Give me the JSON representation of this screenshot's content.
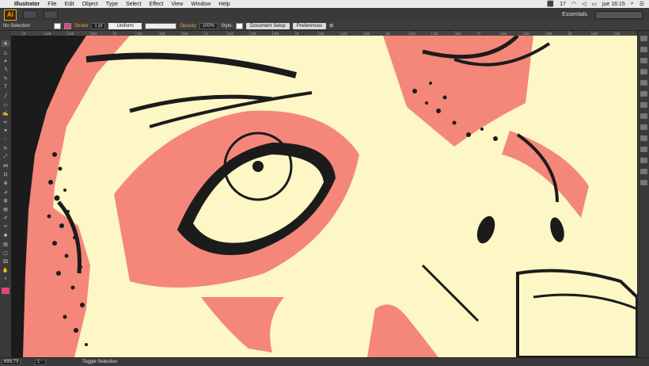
{
  "menubar": {
    "app": "Illustrator",
    "items": [
      "File",
      "Edit",
      "Object",
      "Type",
      "Select",
      "Effect",
      "View",
      "Window",
      "Help"
    ],
    "status": {
      "adobe_count": "17",
      "day_time": "jue 16:15"
    }
  },
  "appbar": {
    "logo": "Ai",
    "workspace": "Essentials"
  },
  "control": {
    "selection": "No Selection",
    "stroke_label": "Stroke",
    "stroke_weight": "1 pt",
    "profile": "Uniform",
    "opacity_label": "Opacity",
    "opacity_value": "100%",
    "style_label": "Style:",
    "document_setup": "Document Setup",
    "preferences": "Preferences"
  },
  "ruler": {
    "ticks": [
      "2",
      "1/4",
      "1/2",
      "3/4",
      "3",
      "1/4",
      "1/2",
      "3/4",
      "4",
      "1/4",
      "1/2",
      "3/4",
      "5",
      "1/4",
      "1/2",
      "3/4",
      "6",
      "1/4",
      "1/2",
      "3/4",
      "7",
      "1/4",
      "1/2",
      "3/4",
      "8",
      "1/4",
      "1/2"
    ]
  },
  "statusbar": {
    "zoom": "899,73",
    "page": "1",
    "tool": "Toggle Selection"
  },
  "icons": {
    "tools": [
      "selection-tool-icon",
      "direct-selection-tool-icon",
      "magic-wand-tool-icon",
      "lasso-tool-icon",
      "pen-tool-icon",
      "type-tool-icon",
      "line-tool-icon",
      "rectangle-tool-icon",
      "paintbrush-tool-icon",
      "pencil-tool-icon",
      "blob-brush-tool-icon",
      "eraser-tool-icon",
      "rotate-tool-icon",
      "scale-tool-icon",
      "width-tool-icon",
      "free-transform-tool-icon",
      "shape-builder-tool-icon",
      "perspective-grid-tool-icon",
      "mesh-tool-icon",
      "gradient-tool-icon",
      "eyedropper-tool-icon",
      "blend-tool-icon",
      "symbol-sprayer-tool-icon",
      "column-graph-tool-icon",
      "artboard-tool-icon",
      "slice-tool-icon",
      "hand-tool-icon",
      "zoom-tool-icon"
    ]
  },
  "colors": {
    "canvas": "#fcf7c5",
    "salmon": "#f4877a",
    "ink": "#1c1b1b",
    "accent": "#f0a03c",
    "ui_bg": "#3a3a3a"
  }
}
